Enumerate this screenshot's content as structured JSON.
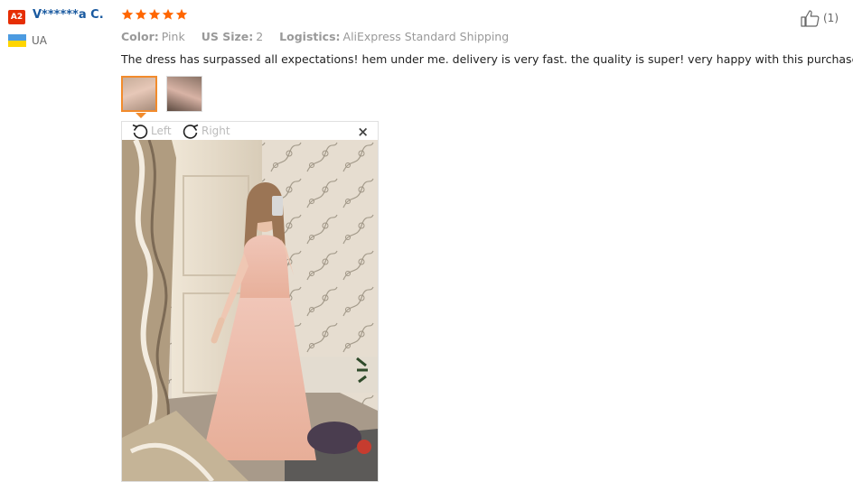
{
  "reviewer": {
    "level_badge": "A2",
    "name": "V******a C.",
    "country": "UA"
  },
  "rating": {
    "stars": 5,
    "max": 5,
    "color": "#f60"
  },
  "helpful": {
    "count_text": "(1)"
  },
  "attributes": [
    {
      "label": "Color:",
      "value": "Pink"
    },
    {
      "label": "US Size:",
      "value": "2"
    },
    {
      "label": "Logistics:",
      "value": "AliExpress Standard Shipping"
    }
  ],
  "review_text": "The dress has surpassed all expectations! hem under me. delivery is very fast. the quality is super! very happy with this purchase.",
  "viewer": {
    "rotate_left": "Left",
    "rotate_right": "Right",
    "close_glyph": "×"
  },
  "colors": {
    "accent": "#f28b2c",
    "name": "#1a5aa0",
    "badge": "#e62e04"
  }
}
